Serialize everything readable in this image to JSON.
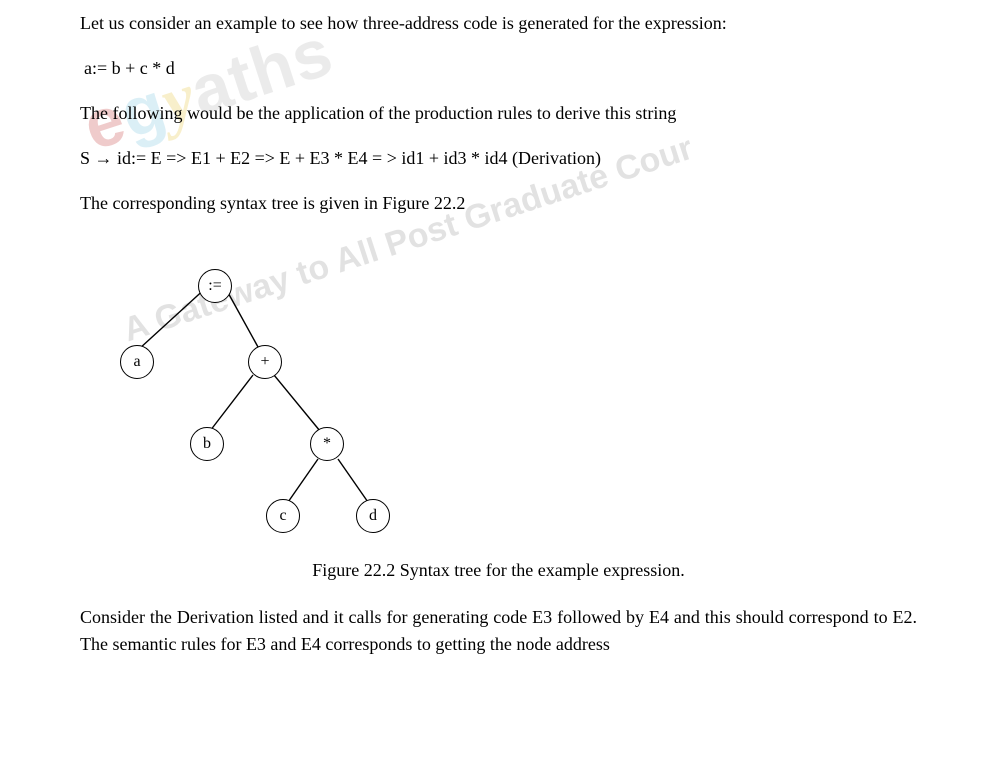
{
  "watermark": {
    "logo_parts": {
      "e": "e",
      "g": "g",
      "y": "y",
      "a": "a",
      "ths": "ths"
    },
    "tagline": "A Gateway to All Post Graduate Cour"
  },
  "paragraphs": {
    "p1": "Let us consider an example to see how three-address code is generated for the expression:",
    "p2": "a:= b + c * d",
    "p3": "The following would be the application of the production rules to derive this string",
    "p4": "S → id:= E => E1 + E2 => E + E3 * E4 = > id1 + id3 * id4   (Derivation)",
    "p5": "The corresponding syntax tree is given in Figure 22.2",
    "caption": "Figure 22.2 Syntax tree for the example expression.",
    "p6": "Consider the Derivation listed and it calls for generating code E3 followed by E4 and this should correspond to E2. The semantic rules for E3 and E4 corresponds to getting the node address"
  },
  "tree": {
    "nodes": {
      "assign": ":=",
      "a": "a",
      "plus": "+",
      "b": "b",
      "mul": "*",
      "c": "c",
      "d": "d"
    }
  }
}
